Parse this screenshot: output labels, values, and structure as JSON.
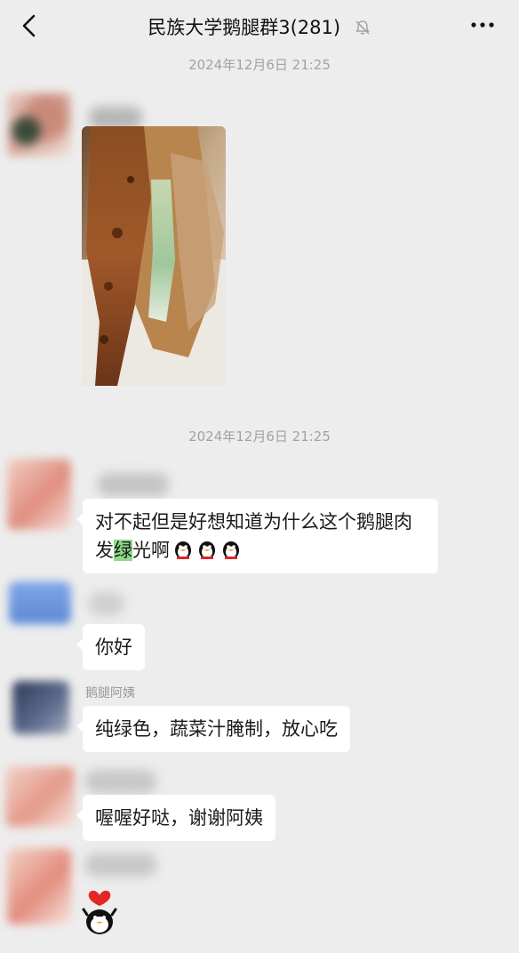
{
  "header": {
    "title": "民族大学鹅腿群3(281)",
    "back_icon": "chevron-left-icon",
    "mute_icon": "bell-off-icon",
    "more_icon": "more-dots-icon"
  },
  "timestamps": [
    "2024年12月6日 21:25",
    "2024年12月6日 21:25"
  ],
  "messages": [
    {
      "type": "image",
      "description_icon": "roast-goose-leg-photo"
    },
    {
      "type": "text",
      "text_before": "对不起但是好想知道为什么这个鹅腿肉发",
      "highlight": "绿",
      "text_after": "光啊",
      "emoji_icon": "penguin-emoji-icon",
      "emoji_count": 3
    },
    {
      "type": "text",
      "text": "你好"
    },
    {
      "type": "text",
      "sender": "鹅腿阿姨",
      "text": "纯绿色，蔬菜汁腌制，放心吃"
    },
    {
      "type": "text",
      "text": "喔喔好哒，谢谢阿姨"
    },
    {
      "type": "sticker",
      "sticker_icon": "heart-penguin-sticker"
    }
  ],
  "colors": {
    "background": "#ededed",
    "bubble": "#ffffff",
    "highlight": "#8fd989",
    "timestamp": "#a2a2a2"
  }
}
